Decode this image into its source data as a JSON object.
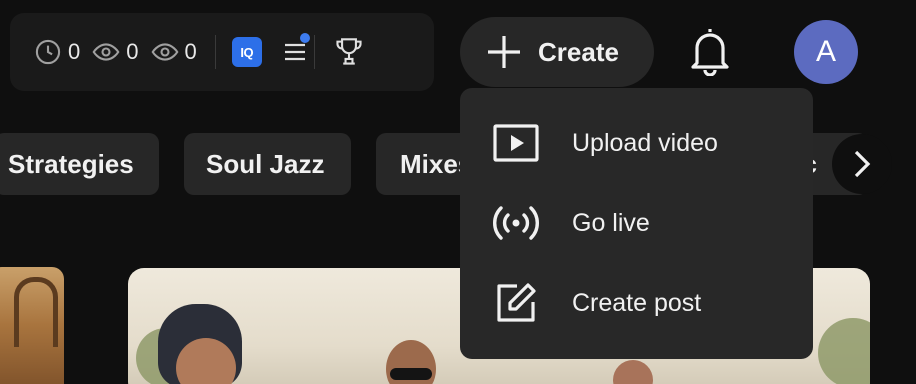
{
  "extension_bar": {
    "stats": [
      {
        "icon": "clock-icon",
        "value": "0"
      },
      {
        "icon": "eye-icon",
        "value": "0"
      },
      {
        "icon": "eye-icon",
        "value": "0"
      }
    ],
    "iq_badge": "IQ",
    "notification_dot_color": "#3d7cf0"
  },
  "header": {
    "create_label": "Create",
    "avatar_initial": "A",
    "avatar_color": "#5c6bc0"
  },
  "chips": [
    "Strategies",
    "Soul Jazz",
    "Mixes",
    "lic"
  ],
  "create_menu": {
    "items": [
      {
        "icon": "video-upload-icon",
        "label": "Upload video"
      },
      {
        "icon": "broadcast-icon",
        "label": "Go live"
      },
      {
        "icon": "edit-post-icon",
        "label": "Create post"
      }
    ]
  }
}
